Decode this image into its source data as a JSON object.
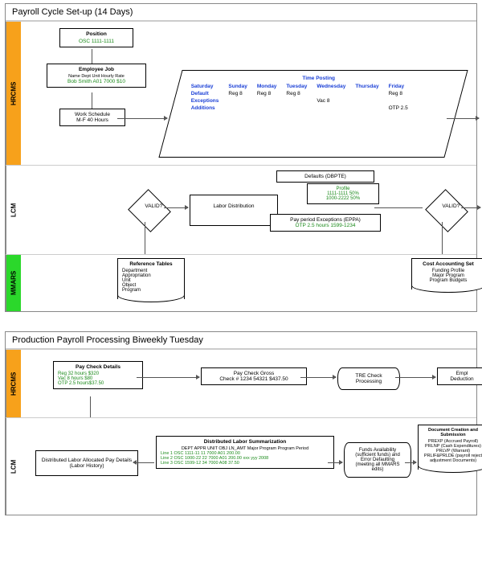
{
  "panel1": {
    "title": "Payroll Cycle Set-up (14 Days)",
    "lanes": {
      "hrcms": "HRCMS",
      "lcm": "LCM",
      "mmars": "MMARS"
    },
    "position": {
      "label": "Position",
      "val": "OSC   1111-1111"
    },
    "empjob": {
      "label": "Employee Job",
      "cols": "Name   Dept   Unit   Hourly Rate",
      "val": "Bob Smith A01  7000  $10"
    },
    "work": {
      "label": "Work Schedule",
      "val": "M-F 40 Hours"
    },
    "timeposting": {
      "title": "Time Posting",
      "days": [
        "Saturday",
        "Sunday",
        "Monday",
        "Tuesday",
        "Wednesday",
        "Thursday",
        "Friday"
      ],
      "rows": [
        {
          "label": "Default",
          "vals": [
            "",
            "Reg 8",
            "Reg 8",
            "Reg 8",
            "",
            "",
            "Reg 8"
          ]
        },
        {
          "label": "Exceptions",
          "vals": [
            "",
            "",
            "",
            "",
            "Vac 8",
            "",
            ""
          ]
        },
        {
          "label": "Additions",
          "vals": [
            "",
            "",
            "",
            "",
            "",
            "",
            "OTP 2.5"
          ]
        }
      ]
    },
    "valid": "VALID?",
    "labdist": "Labor Distribution",
    "defaults": {
      "label": "Defaults (DBPTE)",
      "val": "Profile\n1111-1111 50%\n1000-2222 50%"
    },
    "eppa": {
      "label": "Pay period Exceptions (EPPA)",
      "val": "OTP 2.5 hours 1599-1234"
    },
    "reftables": {
      "label": "Reference Tables",
      "val": "Department\nAppropriation\nUnit\nObject\nProgram"
    },
    "costacct": {
      "label": "Cost Accounting Set",
      "val": "Funding Profile\nMajor Program\nProgram Budgets"
    }
  },
  "panel2": {
    "title": "Production Payroll Processing Biweekly Tuesday",
    "lanes": {
      "hrcms": "HRCMS",
      "lcm": "LCM"
    },
    "paycheck": {
      "label": "Pay Check Details",
      "val": "Reg 32 hours $320\nVac 8 hours $80\nOTP 2.5 hours$37.50"
    },
    "gross": {
      "label": "Pay Check Gross",
      "val": "Check # 1234 54321 $437.50"
    },
    "tre": "TRE Check Processing",
    "empldeduct": "Empl\nDeduction",
    "allocated": "Distributed Labor Allocated Pay Details (Labor History)",
    "summ": {
      "label": "Distributed Labor Summarization",
      "hdr": "DEPT APPR     UNIT OBJ LN_AMT Major Program Program Period",
      "rows": [
        "Line 1  OSC 1111-11 11 7000 A01  200.00",
        "Line 2  OSC 1000-22 22 7000 A01  200.00     xxx     yyy     2008",
        "Line 3  OSC 1599-12 34 7000 A08    37.50"
      ]
    },
    "funds": "Funds Availability (sufficient funds) and Error Defaulting (meeting all MMARS edits)",
    "docs": {
      "label": "Document Creation and Submission",
      "val": "PREXP (Accrued Payroll)\nPRLNP (Cash Expenditures)\nPRLVP (Warrant)\nPRLIF&PRLDE (payroll reject adjustment Documents)"
    }
  }
}
